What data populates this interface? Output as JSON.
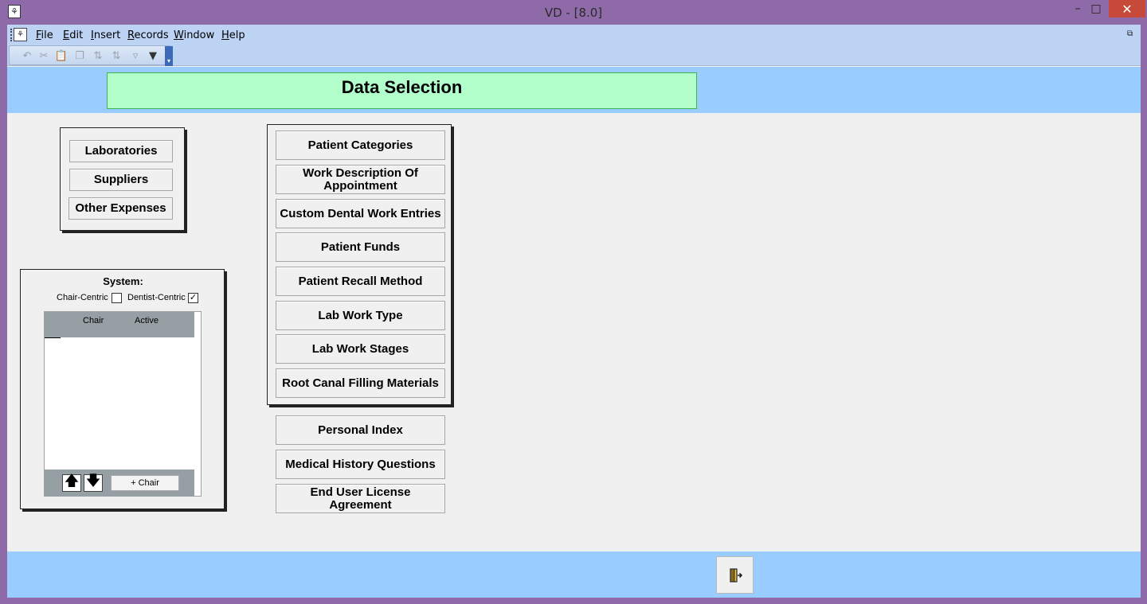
{
  "window": {
    "title": "VD - [8.0]",
    "minimize": "–",
    "maximize": "□",
    "close": "✕",
    "app_icon": "tooth-icon"
  },
  "menu": {
    "items": [
      "File",
      "Edit",
      "Insert",
      "Records",
      "Window",
      "Help"
    ]
  },
  "toolbar": {
    "icons": [
      "undo-icon",
      "cut-icon",
      "paste-icon",
      "copy-icon",
      "sort-ascending-icon",
      "sort-descending-icon",
      "filter-by-selection-icon",
      "filter-icon"
    ]
  },
  "header": {
    "title": "Data Selection"
  },
  "left_panel": {
    "buttons": [
      "Laboratories",
      "Suppliers",
      "Other Expenses"
    ]
  },
  "system_panel": {
    "label": "System:",
    "chair_centric_label": "Chair-Centric",
    "chair_centric_checked": false,
    "dentist_centric_label": "Dentist-Centric",
    "dentist_centric_checked": true,
    "grid_columns": [
      "Chair",
      "Active"
    ],
    "up_icon": "arrow-up-icon",
    "down_icon": "arrow-down-icon",
    "add_chair_label": "+ Chair"
  },
  "center_panel": {
    "buttons": [
      "Patient Categories",
      "Work Description Of Appointment",
      "Custom Dental Work Entries",
      "Patient Funds",
      "Patient Recall Method",
      "Lab Work Type",
      "Lab Work Stages",
      "Root Canal Filling Materials"
    ]
  },
  "extra_buttons": [
    "Personal Index",
    "Medical History Questions",
    "End User License Agreement"
  ],
  "footer": {
    "exit_icon": "exit-door-icon"
  },
  "colors": {
    "band": "#99ccff",
    "title_box": "#b3ffcc",
    "frame": "#8e6aa8"
  }
}
